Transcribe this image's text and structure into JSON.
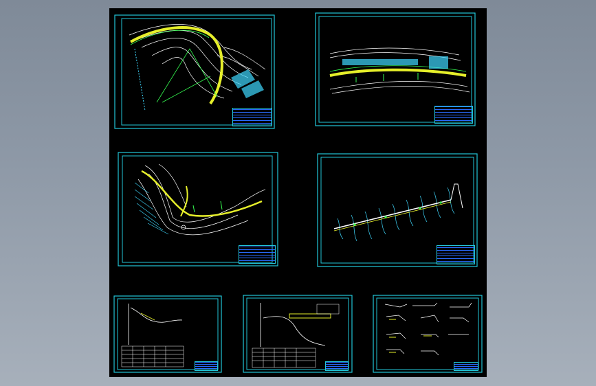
{
  "viewport": {
    "background": "#8a95a2",
    "drawing_background": "#000000"
  },
  "colors": {
    "frame": "#22c6d8",
    "contour": "#ffffff",
    "road": "#e6ef2a",
    "cyan": "#3fd9ff",
    "green": "#36ff52",
    "blue": "#2a6bff",
    "yellow": "#ffff30"
  },
  "sheets": [
    {
      "id": "plan-curve",
      "kind": "site-plan"
    },
    {
      "id": "plan-road-strip",
      "kind": "site-plan"
    },
    {
      "id": "plan-hillside",
      "kind": "site-plan"
    },
    {
      "id": "plan-road-straight",
      "kind": "site-plan"
    },
    {
      "id": "profile-1",
      "kind": "longitudinal-profile"
    },
    {
      "id": "profile-2",
      "kind": "longitudinal-profile"
    },
    {
      "id": "details",
      "kind": "detail-sheet"
    }
  ]
}
